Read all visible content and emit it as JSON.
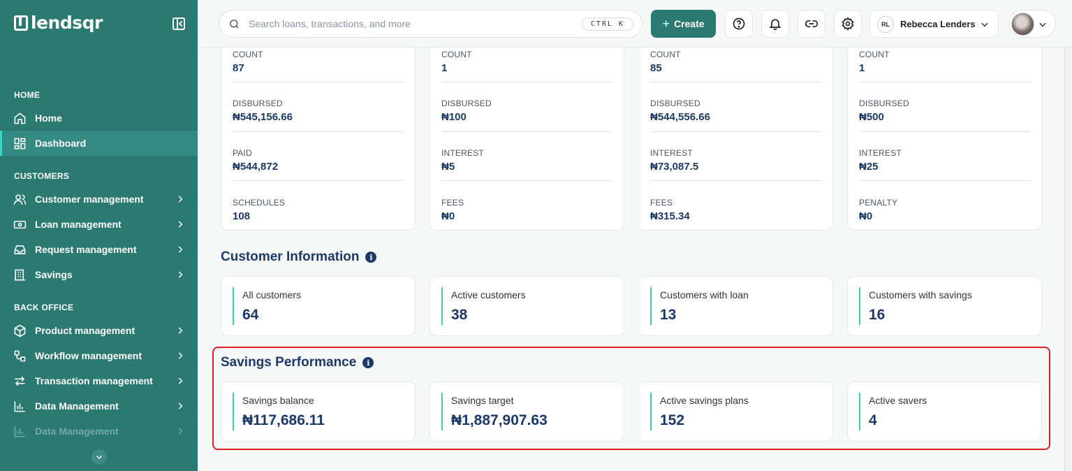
{
  "brand": {
    "name": "lendsqr"
  },
  "sidebar": {
    "sections": [
      {
        "title": "HOME",
        "items": [
          {
            "label": "Home",
            "icon": "home-icon"
          },
          {
            "label": "Dashboard",
            "icon": "dashboard-icon"
          }
        ]
      },
      {
        "title": "CUSTOMERS",
        "items": [
          {
            "label": "Customer management",
            "icon": "users-icon"
          },
          {
            "label": "Loan management",
            "icon": "banknote-icon"
          },
          {
            "label": "Request management",
            "icon": "inbox-icon"
          },
          {
            "label": "Savings",
            "icon": "piggybank-icon"
          }
        ]
      },
      {
        "title": "BACK OFFICE",
        "items": [
          {
            "label": "Product management",
            "icon": "box-icon"
          },
          {
            "label": "Workflow management",
            "icon": "workflow-icon"
          },
          {
            "label": "Transaction management",
            "icon": "transfer-icon"
          },
          {
            "label": "Data Management",
            "icon": "bar-chart-icon"
          },
          {
            "label": "Data Management",
            "icon": "bar-chart-icon"
          }
        ]
      }
    ],
    "active_item": "Dashboard"
  },
  "topbar": {
    "search_placeholder": "Search loans, transactions, and more",
    "shortcut": "CTRL K",
    "create_label": "Create",
    "user_initials": "RL",
    "user_name": "Rebecca Lenders"
  },
  "loan_cards": [
    {
      "stats": [
        {
          "label": "COUNT",
          "value": "87"
        },
        {
          "label": "DISBURSED",
          "value": "₦545,156.66"
        },
        {
          "label": "PAID",
          "value": "₦544,872"
        },
        {
          "label": "SCHEDULES",
          "value": "108"
        }
      ]
    },
    {
      "stats": [
        {
          "label": "COUNT",
          "value": "1"
        },
        {
          "label": "DISBURSED",
          "value": "₦100"
        },
        {
          "label": "INTEREST",
          "value": "₦5"
        },
        {
          "label": "FEES",
          "value": "₦0"
        }
      ]
    },
    {
      "stats": [
        {
          "label": "COUNT",
          "value": "85"
        },
        {
          "label": "DISBURSED",
          "value": "₦544,556.66"
        },
        {
          "label": "INTEREST",
          "value": "₦73,087.5"
        },
        {
          "label": "FEES",
          "value": "₦315.34"
        }
      ]
    },
    {
      "stats": [
        {
          "label": "COUNT",
          "value": "1"
        },
        {
          "label": "DISBURSED",
          "value": "₦500"
        },
        {
          "label": "INTEREST",
          "value": "₦25"
        },
        {
          "label": "PENALTY",
          "value": "₦0"
        }
      ]
    }
  ],
  "customer_info": {
    "title": "Customer Information",
    "cards": [
      {
        "label": "All customers",
        "value": "64"
      },
      {
        "label": "Active customers",
        "value": "38"
      },
      {
        "label": "Customers with loan",
        "value": "13"
      },
      {
        "label": "Customers with savings",
        "value": "16"
      }
    ]
  },
  "savings_performance": {
    "title": "Savings Performance",
    "cards": [
      {
        "label": "Savings balance",
        "value": "₦117,686.11"
      },
      {
        "label": "Savings target",
        "value": "₦1,887,907.63"
      },
      {
        "label": "Active savings plans",
        "value": "152"
      },
      {
        "label": "Active savers",
        "value": "4"
      }
    ]
  },
  "colors": {
    "sidebar": "#2a7a72",
    "accent": "#3ec9b8",
    "text_primary": "#1b3a6b",
    "highlight": "#e0202a"
  }
}
